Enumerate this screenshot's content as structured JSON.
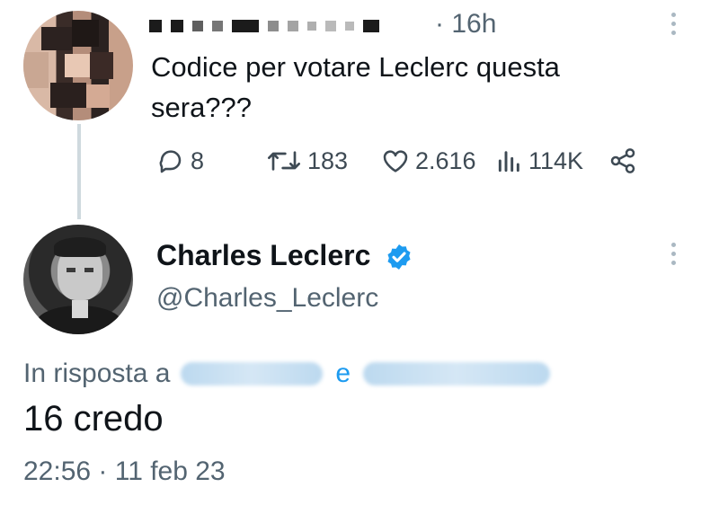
{
  "tweet_parent": {
    "author_name_redacted": "",
    "time": "· 16h",
    "text": "Codice per votare Leclerc questa sera???",
    "actions": {
      "replies": "8",
      "retweets": "183",
      "likes": "2.616",
      "views": "114K"
    }
  },
  "tweet_reply": {
    "name": "Charles Leclerc",
    "handle": "@Charles_Leclerc",
    "reply_prefix": "In risposta a",
    "reply_and": "e",
    "text": "16 credo",
    "timestamp": "22:56 · 11 feb 23"
  },
  "icons": {
    "reply": "reply-icon",
    "retweet": "retweet-icon",
    "like": "heart-icon",
    "views": "views-icon",
    "share": "share-icon",
    "verified": "verified-badge-icon",
    "more": "more-icon"
  },
  "colors": {
    "text": "#0f1419",
    "secondary": "#536471",
    "accent": "#1d9bf0"
  }
}
